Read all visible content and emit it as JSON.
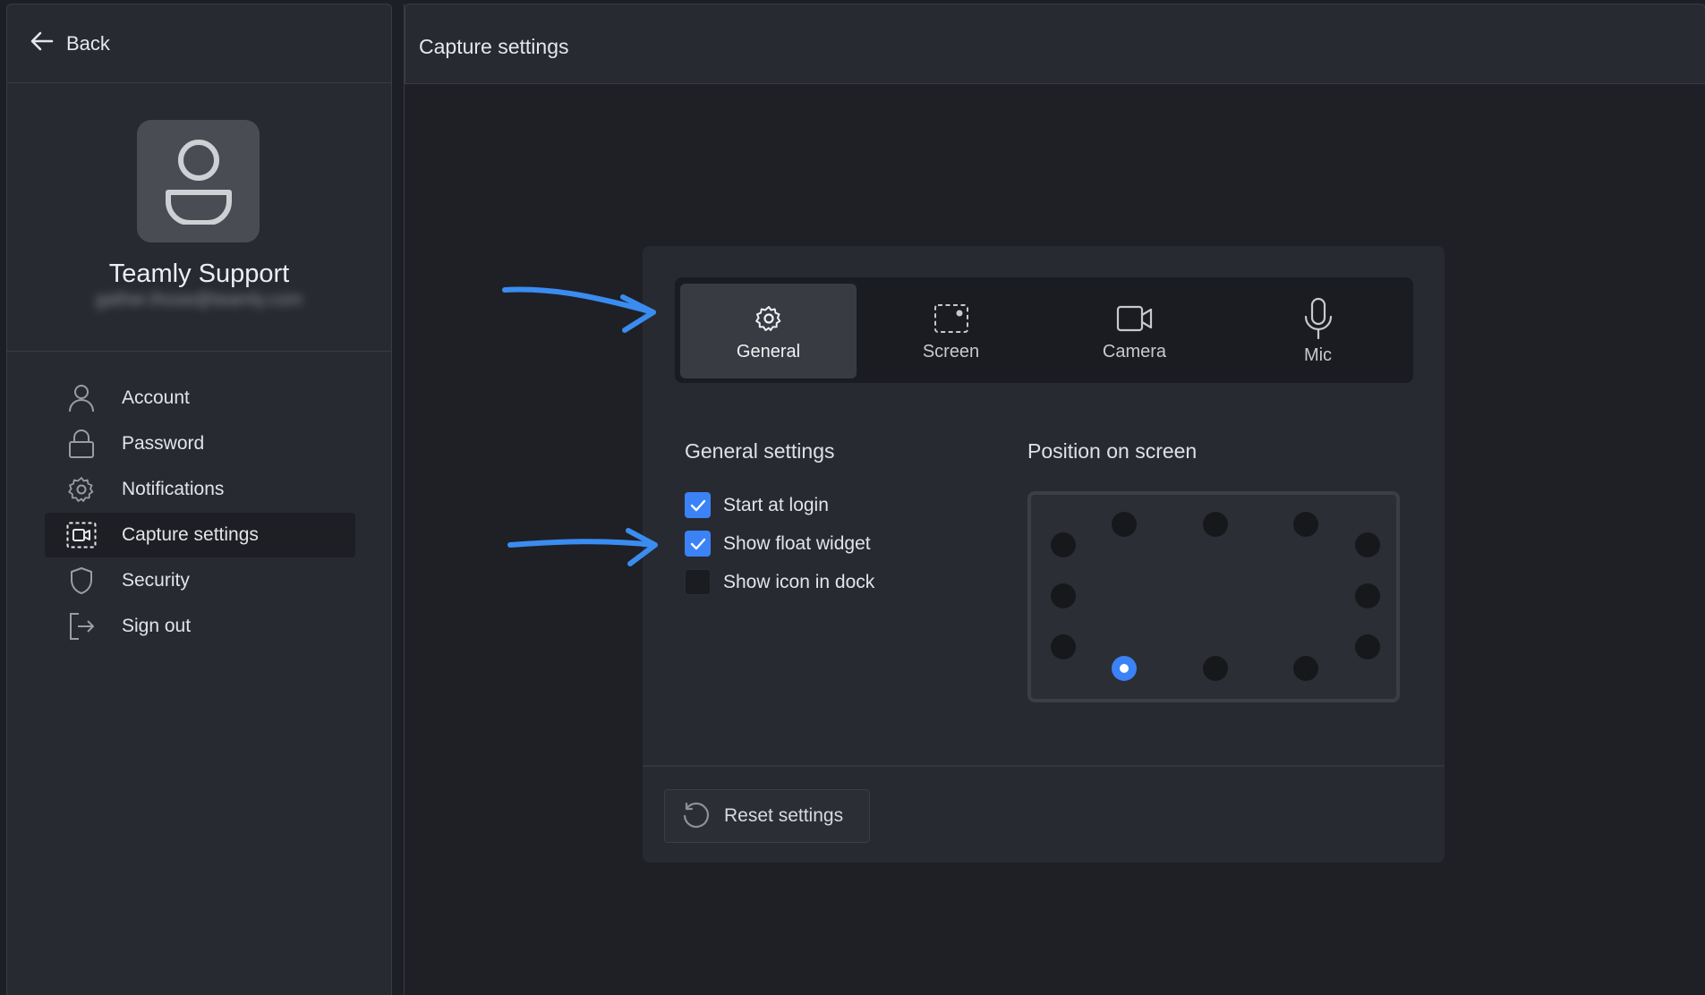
{
  "sidebar": {
    "back_label": "Back",
    "profile": {
      "name": "Teamly Support",
      "email": "gather.those@teamly.com"
    },
    "items": [
      {
        "label": "Account",
        "icon": "user-icon",
        "active": false
      },
      {
        "label": "Password",
        "icon": "lock-icon",
        "active": false
      },
      {
        "label": "Notifications",
        "icon": "gear-icon",
        "active": false
      },
      {
        "label": "Capture settings",
        "icon": "capture-icon",
        "active": true
      },
      {
        "label": "Security",
        "icon": "shield-icon",
        "active": false
      },
      {
        "label": "Sign out",
        "icon": "sign-out-icon",
        "active": false
      }
    ]
  },
  "header": {
    "title": "Capture settings"
  },
  "tabs": [
    {
      "label": "General",
      "icon": "gear-icon",
      "active": true
    },
    {
      "label": "Screen",
      "icon": "screen-region-icon",
      "active": false
    },
    {
      "label": "Camera",
      "icon": "video-camera-icon",
      "active": false
    },
    {
      "label": "Mic",
      "icon": "microphone-icon",
      "active": false
    }
  ],
  "general": {
    "title": "General settings",
    "options": [
      {
        "label": "Start at login",
        "checked": true
      },
      {
        "label": "Show float widget",
        "checked": true
      },
      {
        "label": "Show icon in dock",
        "checked": false
      }
    ]
  },
  "position": {
    "title": "Position on screen",
    "selected": "bottom-left"
  },
  "reset_label": "Reset settings",
  "colors": {
    "accent": "#3b82f6",
    "background": "#1d1f25",
    "panel": "#282a31",
    "annotation_arrow": "#3b8cf0"
  }
}
